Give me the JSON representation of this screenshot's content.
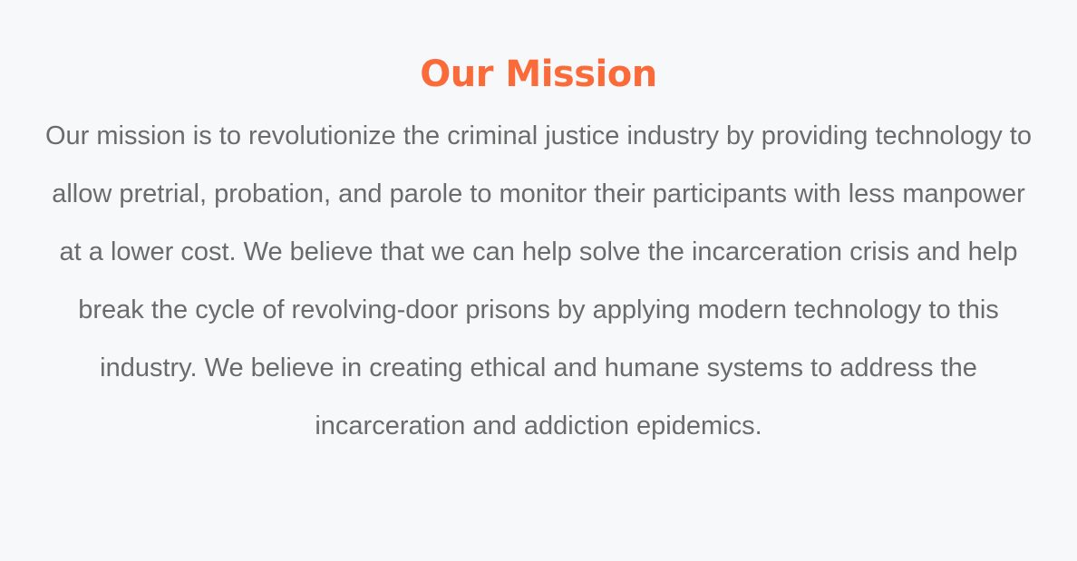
{
  "mission": {
    "title": "Our Mission",
    "body": "Our mission is to revolutionize the criminal justice industry by providing technology to allow pretrial, probation, and parole to monitor their participants with less manpower at a lower cost. We believe that we can help solve the incarceration crisis and help break the cycle of revolving-door prisons by applying modern technology to this industry. We believe in creating ethical and humane systems to address the incarceration and addiction epidemics."
  },
  "colors": {
    "accent": "#fb6a39",
    "body_text": "#6b6b6b",
    "background": "#f7f8f9"
  }
}
